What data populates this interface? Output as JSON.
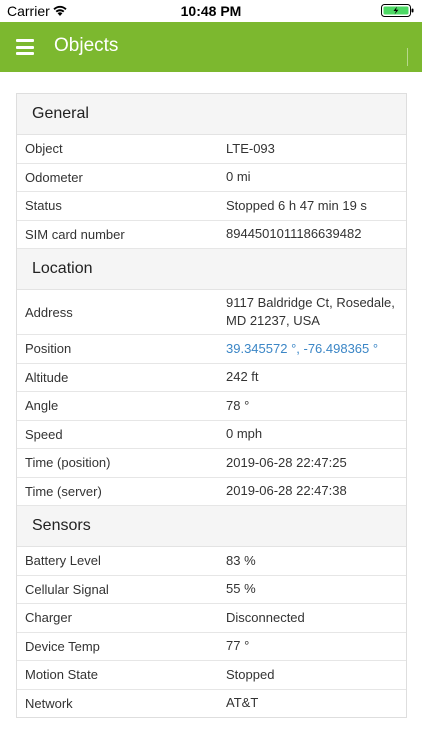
{
  "status_bar": {
    "carrier": "Carrier",
    "time": "10:48 PM",
    "wifi_icon": "wifi-icon",
    "battery_icon": "battery-icon"
  },
  "app_bar": {
    "title": "Objects",
    "menu_icon": "hamburger-menu-icon",
    "color": "#7cb82f"
  },
  "general": {
    "title": "General",
    "rows": [
      {
        "label": "Object",
        "value": "LTE-093"
      },
      {
        "label": "Odometer",
        "value": "0 mi"
      },
      {
        "label": "Status",
        "value": "Stopped 6 h 47 min 19 s"
      },
      {
        "label": "SIM card number",
        "value": "8944501011186639482"
      }
    ]
  },
  "location": {
    "title": "Location",
    "address_label": "Address",
    "address_line1": "9117 Baldridge Ct, Rosedale,",
    "address_line2": "MD 21237, USA",
    "position_label": "Position",
    "position_value": "39.345572 °, -76.498365 °",
    "link_color": "#3b86c6",
    "rows": [
      {
        "label": "Altitude",
        "value": "242 ft"
      },
      {
        "label": "Angle",
        "value": "78 °"
      },
      {
        "label": "Speed",
        "value": "0 mph"
      },
      {
        "label": "Time (position)",
        "value": "2019-06-28 22:47:25"
      },
      {
        "label": "Time (server)",
        "value": "2019-06-28 22:47:38"
      }
    ]
  },
  "sensors": {
    "title": "Sensors",
    "rows": [
      {
        "label": "Battery Level",
        "value": "83 %"
      },
      {
        "label": "Cellular Signal",
        "value": "55 %"
      },
      {
        "label": "Charger",
        "value": "Disconnected"
      },
      {
        "label": "Device Temp",
        "value": "77 °"
      },
      {
        "label": "Motion State",
        "value": "Stopped"
      },
      {
        "label": "Network",
        "value": "AT&T"
      }
    ]
  }
}
